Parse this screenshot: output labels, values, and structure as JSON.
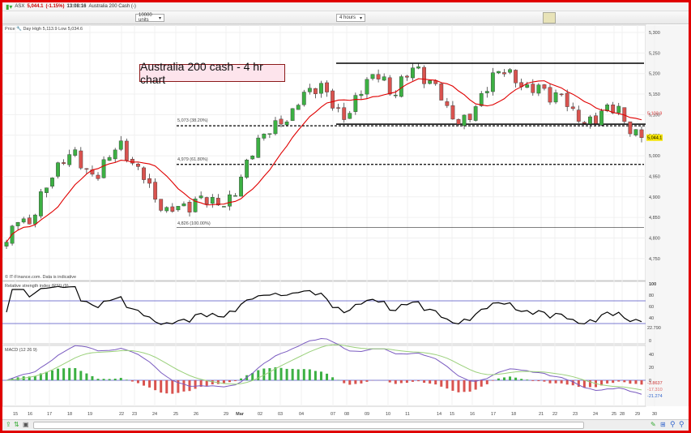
{
  "header": {
    "symbol": "ASX",
    "price": "5,044.1",
    "change": "(-1.15%)",
    "time": "13:08:16",
    "instrument": "Australia 200 Cash (-)"
  },
  "toolbar": {
    "units": "10000 units",
    "interval": "4 hours"
  },
  "price_panel": {
    "label": "Price",
    "day_range": "Day High 5,113.9 Low 5,034.6",
    "watermark": "© IT-Finance.com. Data is indicative",
    "annotation": "Australia 200 cash - 4 hr chart",
    "axis_ticks": [
      "5,300",
      "5,250",
      "5,200",
      "5,150",
      "5,100",
      "5,050",
      "5,000",
      "4,950",
      "4,900",
      "4,850",
      "4,800",
      "4,750"
    ],
    "ma_value": "5,103.9",
    "last_value": "5,044.1",
    "fib_labels": [
      "5,073 (38.20%)",
      "4,979 (61.80%)",
      "4,826 (100.00%)"
    ]
  },
  "rsi_panel": {
    "label": "Relative strength index (RSI) (9)",
    "axis_ticks": [
      "100",
      "80",
      "60",
      "40",
      "0"
    ],
    "value": "22.790"
  },
  "macd_panel": {
    "label": "MACD (12 26 9)",
    "axis_ticks": [
      "40",
      "20",
      "0"
    ],
    "values": [
      "-3.8637",
      "-17.310",
      "-21.274"
    ]
  },
  "date_axis": [
    "15",
    "16",
    "17",
    "18",
    "19",
    "22",
    "23",
    "24",
    "25",
    "26",
    "29",
    "Mar",
    "02",
    "03",
    "04",
    "07",
    "08",
    "09",
    "10",
    "11",
    "14",
    "15",
    "16",
    "17",
    "18",
    "21",
    "22",
    "23",
    "24",
    "25",
    "28",
    "29",
    "30"
  ],
  "colors": {
    "bull": "#3cb043",
    "bear": "#d9534f",
    "ma": "#e00000",
    "frame": "#e00000"
  },
  "chart_data": {
    "type": "candlestick",
    "title": "Australia 200 cash - 4 hr chart",
    "ylim": [
      4750,
      5300
    ],
    "levels": {
      "resistance": 5225,
      "support": 5075,
      "fib_38": 5073,
      "fib_62": 4979,
      "fib_100": 4826
    },
    "close_waypoints": [
      4790,
      4850,
      4830,
      4900,
      4950,
      4990,
      5010,
      4960,
      4950,
      5000,
      5030,
      4980,
      4960,
      4900,
      4860,
      4880,
      4870,
      4900,
      4890,
      4880,
      4900,
      4970,
      5030,
      5060,
      5080,
      5090,
      5150,
      5160,
      5170,
      5110,
      5090,
      5150,
      5190,
      5200,
      5140,
      5190,
      5220,
      5180,
      5170,
      5100,
      5080,
      5100,
      5150,
      5200,
      5210,
      5180,
      5160,
      5170,
      5140,
      5150,
      5100,
      5080,
      5090,
      5120,
      5110,
      5060,
      5044
    ]
  }
}
